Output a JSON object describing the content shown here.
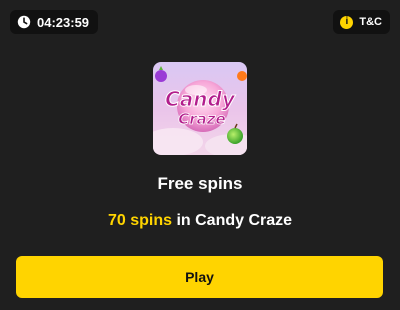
{
  "timer": {
    "icon": "clock-icon",
    "value": "04:23:59"
  },
  "terms": {
    "icon": "info-icon",
    "icon_glyph": "i",
    "label": "T&C"
  },
  "game": {
    "thumbnail_icon": "candy-craze-logo",
    "logo_line1": "Candy",
    "logo_line2": "Craze"
  },
  "offer": {
    "title": "Free spins",
    "spins_highlight": "70 spins",
    "spins_rest": " in Candy Craze"
  },
  "actions": {
    "play_label": "Play"
  },
  "colors": {
    "background": "#1f1f1f",
    "pill": "#111111",
    "accent": "#ffd400",
    "text": "#ffffff"
  }
}
